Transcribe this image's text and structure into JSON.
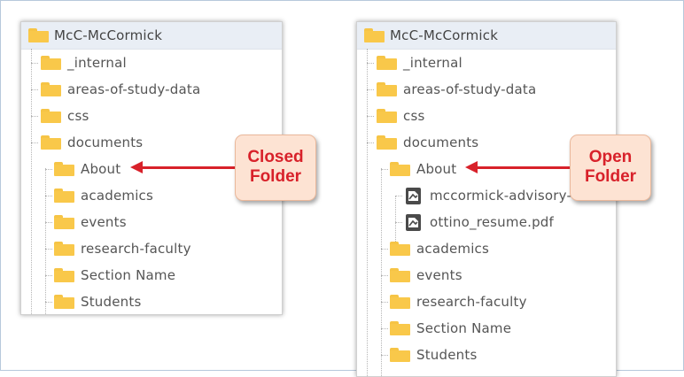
{
  "closed_panel": {
    "root": "McC-McCormick",
    "items": [
      {
        "label": "_internal"
      },
      {
        "label": "areas-of-study-data"
      },
      {
        "label": "css"
      },
      {
        "label": "documents"
      },
      {
        "label": "About"
      },
      {
        "label": "academics"
      },
      {
        "label": "events"
      },
      {
        "label": "research-faculty"
      },
      {
        "label": "Section Name"
      },
      {
        "label": "Students"
      }
    ]
  },
  "open_panel": {
    "root": "McC-McCormick",
    "items": [
      {
        "label": "_internal"
      },
      {
        "label": "areas-of-study-data"
      },
      {
        "label": "css"
      },
      {
        "label": "documents"
      },
      {
        "label": "About"
      },
      {
        "label": "mccormick-advisory-"
      },
      {
        "label": "ottino_resume.pdf"
      },
      {
        "label": "academics"
      },
      {
        "label": "events"
      },
      {
        "label": "research-faculty"
      },
      {
        "label": "Section Name"
      },
      {
        "label": "Students"
      }
    ]
  },
  "callouts": {
    "closed": {
      "line1": "Closed",
      "line2": "Folder"
    },
    "open": {
      "line1": "Open",
      "line2": "Folder"
    }
  },
  "colors": {
    "folder": "#f9c84a",
    "callout_bg": "#fde3d3",
    "callout_text": "#d8212a",
    "arrow": "#d8212a",
    "header_bg": "#e9eef5"
  }
}
